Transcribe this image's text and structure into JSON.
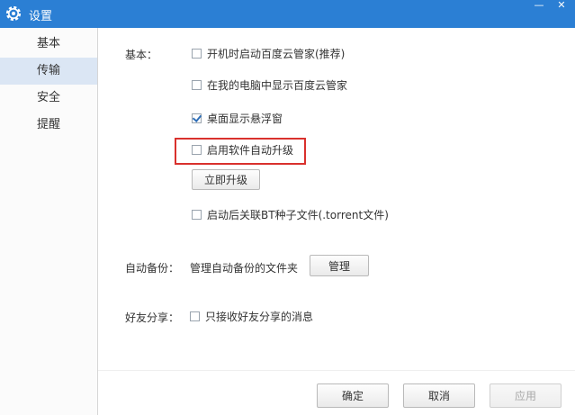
{
  "window": {
    "title": "设置",
    "minimize_glyph": "—",
    "close_glyph": "✕",
    "accent_color": "#2b7fd4"
  },
  "sidebar": {
    "items": [
      {
        "label": "基本",
        "selected": false
      },
      {
        "label": "传输",
        "selected": true
      },
      {
        "label": "安全",
        "selected": false
      },
      {
        "label": "提醒",
        "selected": false
      }
    ]
  },
  "basic": {
    "section_label": "基本：",
    "options": [
      {
        "label": "开机时启动百度云管家(推荐)",
        "checked": false
      },
      {
        "label": "在我的电脑中显示百度云管家",
        "checked": false
      },
      {
        "label": "桌面显示悬浮窗",
        "checked": true
      },
      {
        "label": "启用软件自动升级",
        "checked": false
      },
      {
        "label": "启动后关联BT种子文件(.torrent文件)",
        "checked": false
      }
    ],
    "upgrade_button": "立即升级"
  },
  "backup": {
    "section_label": "自动备份：",
    "description": "管理自动备份的文件夹",
    "manage_button": "管理"
  },
  "share": {
    "section_label": "好友分享：",
    "option": {
      "label": "只接收好友分享的消息",
      "checked": false
    }
  },
  "footer": {
    "ok": "确定",
    "cancel": "取消",
    "apply": "应用"
  }
}
